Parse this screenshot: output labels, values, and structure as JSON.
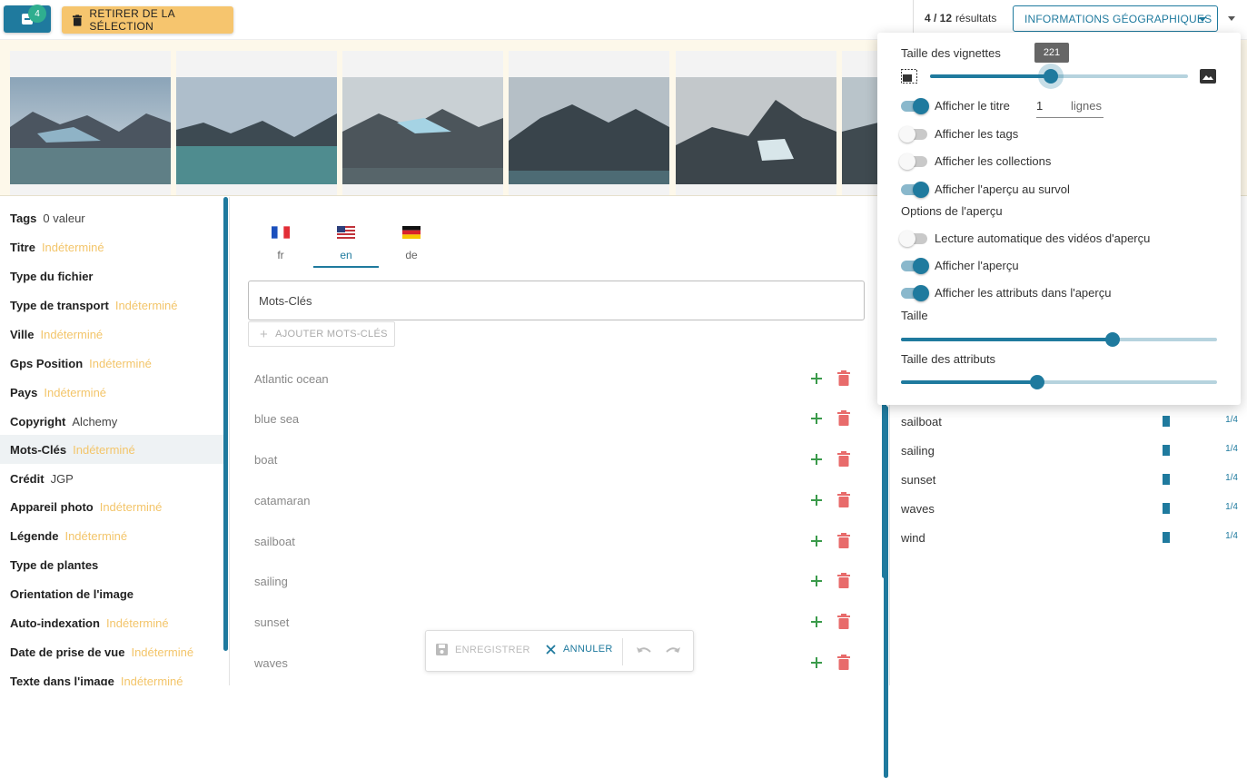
{
  "topbar": {
    "basket_count": "4",
    "remove_label": "RETIRER DE LA SÉLECTION",
    "results_current": "4 / 12",
    "results_label": "résultats",
    "geo_label": "INFORMATIONS GÉOGRAPHIQUES"
  },
  "attributes": [
    {
      "name": "Tags",
      "value": "0 valeur",
      "undetermined": false
    },
    {
      "name": "Titre",
      "value": "Indéterminé",
      "undetermined": true
    },
    {
      "name": "Type du fichier",
      "value": "",
      "undetermined": false
    },
    {
      "name": "Type de transport",
      "value": "Indéterminé",
      "undetermined": true
    },
    {
      "name": "Ville",
      "value": "Indéterminé",
      "undetermined": true
    },
    {
      "name": "Gps Position",
      "value": "Indéterminé",
      "undetermined": true
    },
    {
      "name": "Pays",
      "value": "Indéterminé",
      "undetermined": true
    },
    {
      "name": "Copyright",
      "value": "Alchemy",
      "undetermined": false
    },
    {
      "name": "Mots-Clés",
      "value": "Indéterminé",
      "undetermined": true,
      "selected": true
    },
    {
      "name": "Crédit",
      "value": "JGP",
      "undetermined": false
    },
    {
      "name": "Appareil photo",
      "value": "Indéterminé",
      "undetermined": true
    },
    {
      "name": "Légende",
      "value": "Indéterminé",
      "undetermined": true
    },
    {
      "name": "Type de plantes",
      "value": "",
      "undetermined": false
    },
    {
      "name": "Orientation de l'image",
      "value": "",
      "undetermined": false
    },
    {
      "name": "Auto-indexation",
      "value": "Indéterminé",
      "undetermined": true
    },
    {
      "name": "Date de prise de vue",
      "value": "Indéterminé",
      "undetermined": true
    },
    {
      "name": "Texte dans l'image",
      "value": "Indéterminé",
      "undetermined": true
    }
  ],
  "languages": [
    {
      "code": "fr",
      "active": false
    },
    {
      "code": "en",
      "active": true
    },
    {
      "code": "de",
      "active": false
    }
  ],
  "editor": {
    "field_label": "Mots-Clés",
    "add_label": "AJOUTER MOTS-CLÉS",
    "keywords": [
      "Atlantic ocean",
      "blue sea",
      "boat",
      "catamaran",
      "sailboat",
      "sailing",
      "sunset",
      "waves"
    ]
  },
  "savebar": {
    "save_label": "ENREGISTRER",
    "cancel_label": "ANNULER"
  },
  "right_list": [
    {
      "label": "sailboat",
      "count": "1/4",
      "fraction": 0.25
    },
    {
      "label": "sailing",
      "count": "1/4",
      "fraction": 0.25
    },
    {
      "label": "sunset",
      "count": "1/4",
      "fraction": 0.25
    },
    {
      "label": "waves",
      "count": "1/4",
      "fraction": 0.25
    },
    {
      "label": "wind",
      "count": "1/4",
      "fraction": 0.25
    }
  ],
  "settings": {
    "thumb_size_label": "Taille des vignettes",
    "thumb_size_value": "221",
    "thumb_size_fraction": 0.47,
    "show_title_label": "Afficher le titre",
    "show_title_on": true,
    "title_lines_value": "1",
    "title_lines_unit": "lignes",
    "show_tags_label": "Afficher les tags",
    "show_tags_on": false,
    "show_collections_label": "Afficher les collections",
    "show_collections_on": false,
    "show_hover_preview_label": "Afficher l'aperçu au survol",
    "show_hover_preview_on": true,
    "preview_options_label": "Options de l'aperçu",
    "autoplay_label": "Lecture automatique des vidéos d'aperçu",
    "autoplay_on": false,
    "show_preview_label": "Afficher l'aperçu",
    "show_preview_on": true,
    "show_attrs_label": "Afficher les attributs dans l'aperçu",
    "show_attrs_on": true,
    "size_label": "Taille",
    "size_fraction": 0.67,
    "attr_size_label": "Taille des attributs",
    "attr_size_fraction": 0.43
  },
  "colors": {
    "primary": "#1f7a9e",
    "warning": "#f6c56e",
    "undetermined": "#f3c56a",
    "add_green": "#3a9a4a",
    "delete_red": "#e86b6b"
  }
}
